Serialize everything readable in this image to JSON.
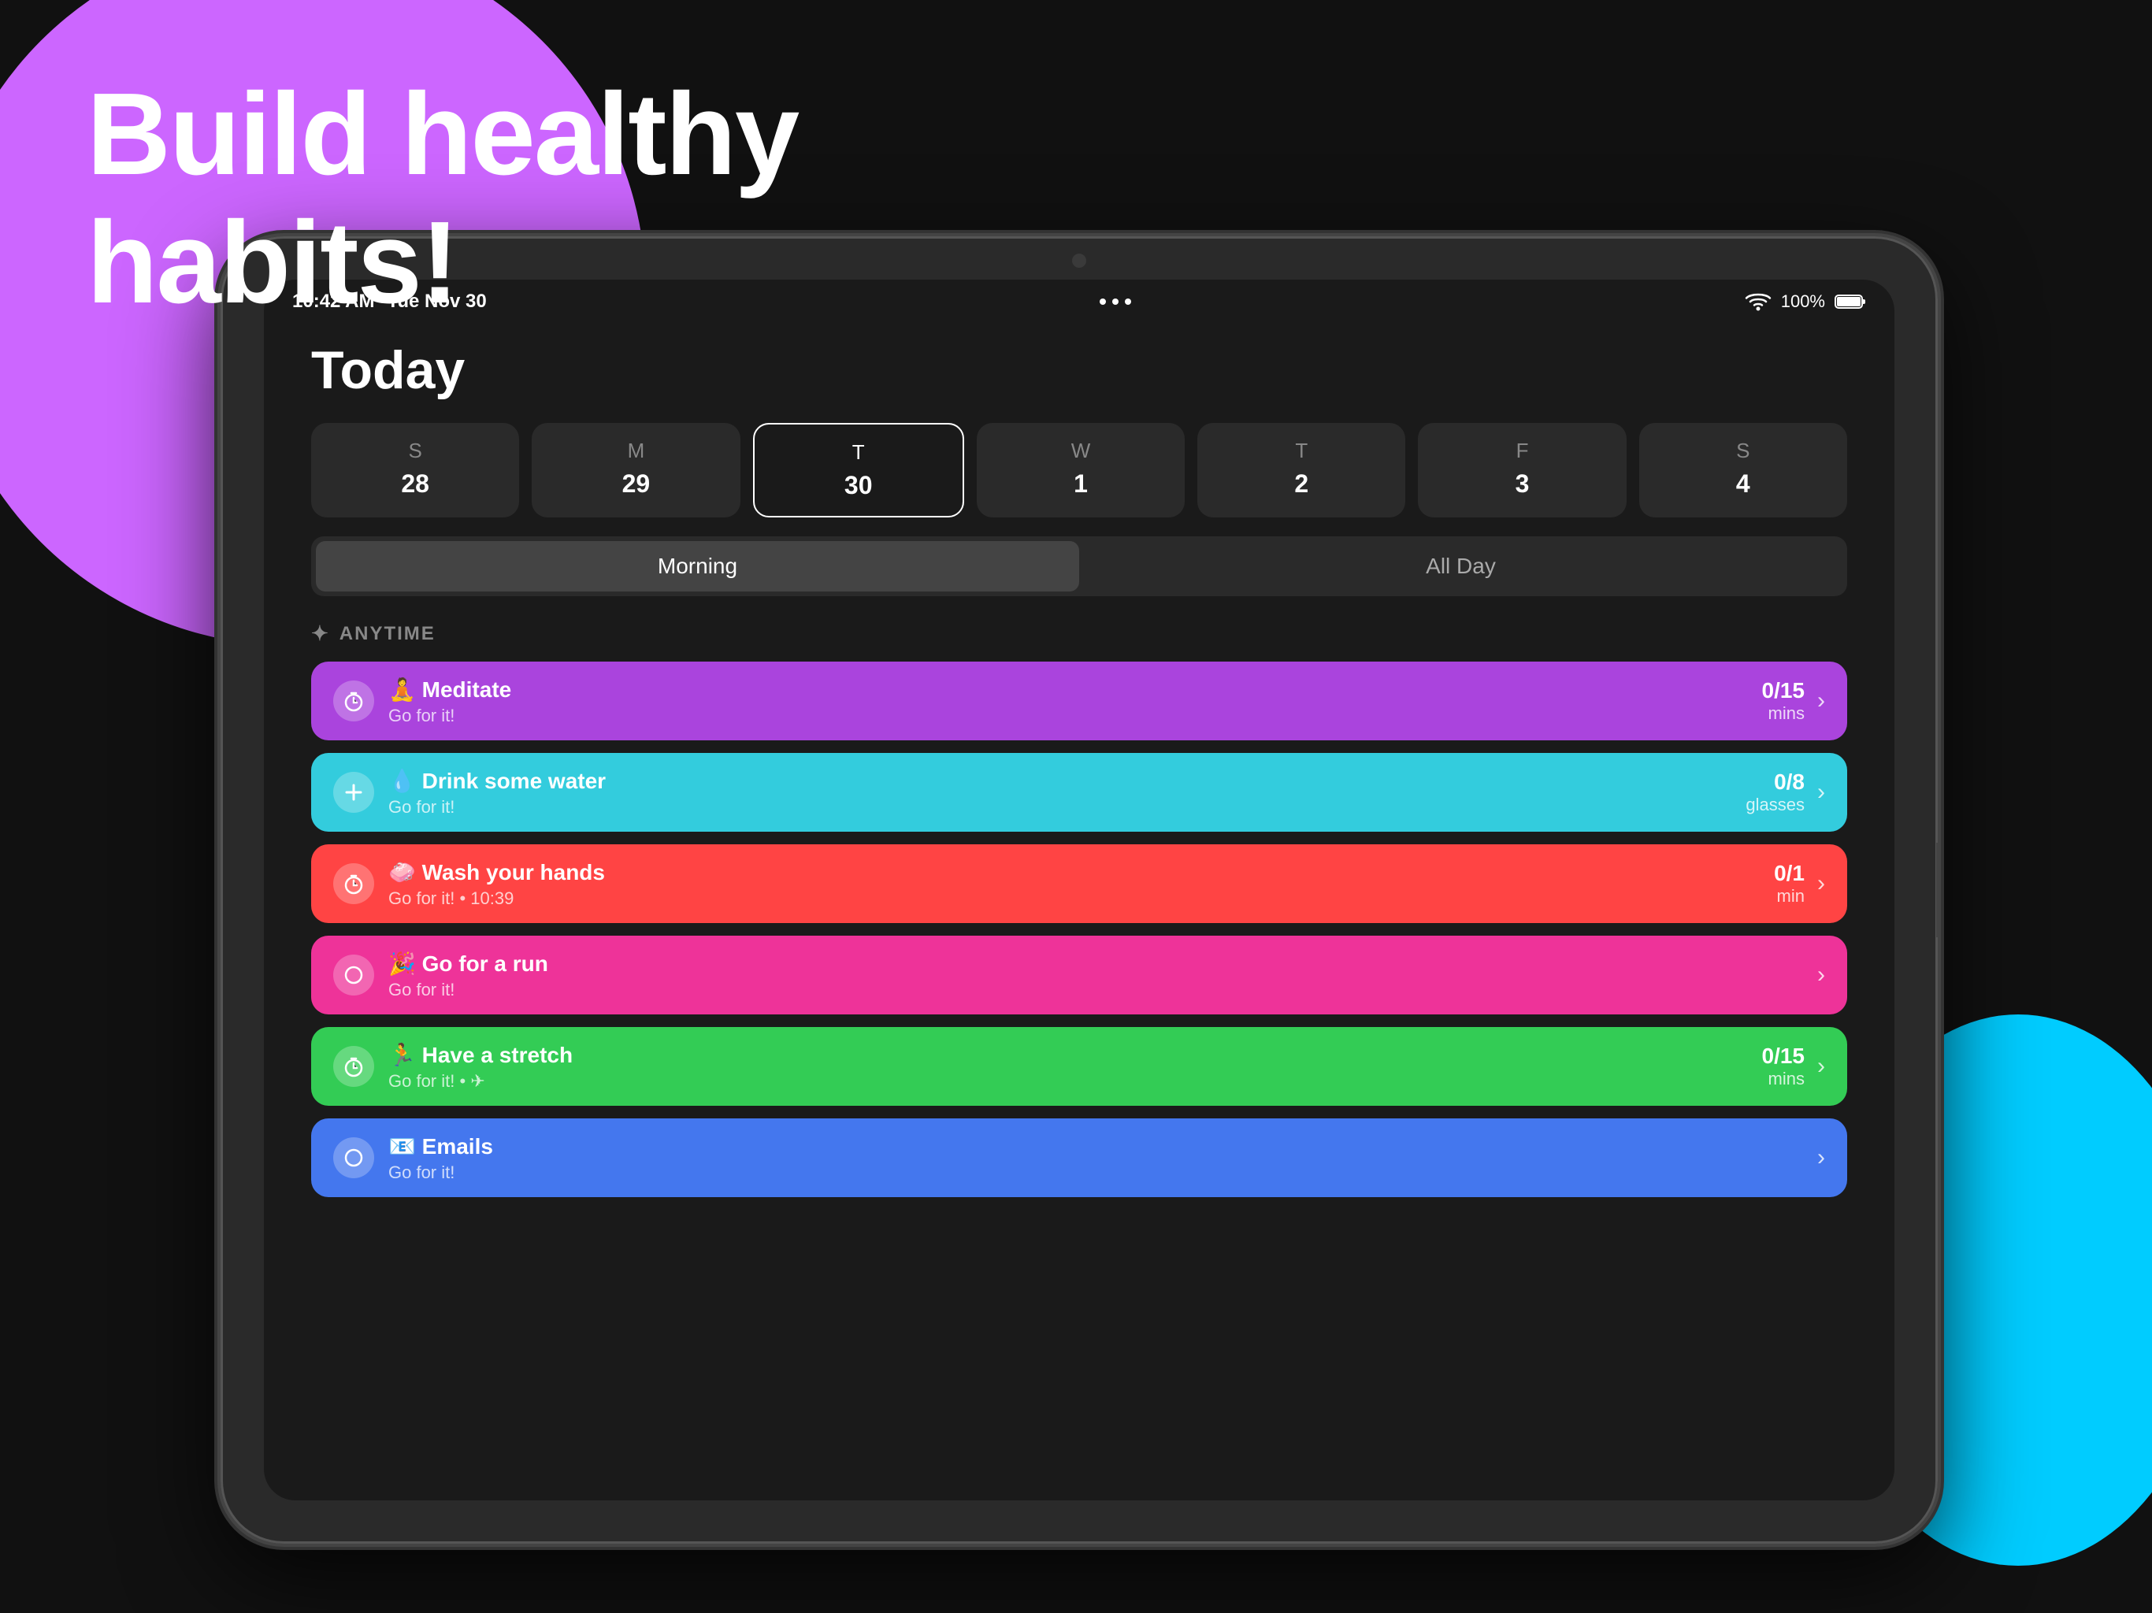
{
  "background": {
    "headline_line1": "Build healthy",
    "headline_line2": "habits!"
  },
  "status_bar": {
    "time": "10:42 AM",
    "date": "Tue Nov 30",
    "battery": "100%"
  },
  "app": {
    "title": "Today",
    "section_label": "ANYTIME",
    "days": [
      {
        "letter": "S",
        "number": "28",
        "active": false
      },
      {
        "letter": "M",
        "number": "29",
        "active": false
      },
      {
        "letter": "T",
        "number": "30",
        "active": true
      },
      {
        "letter": "W",
        "number": "1",
        "active": false
      },
      {
        "letter": "T",
        "number": "2",
        "active": false
      },
      {
        "letter": "F",
        "number": "3",
        "active": false
      },
      {
        "letter": "S",
        "number": "4",
        "active": false
      }
    ],
    "tabs": [
      {
        "label": "Morning",
        "active": true
      },
      {
        "label": "All Day",
        "active": false
      }
    ],
    "habits": [
      {
        "emoji": "🧘",
        "name": "Meditate",
        "subtitle": "Go for it!",
        "count": "0/15",
        "unit": "mins",
        "color_class": "habit-purple",
        "has_chevron": true,
        "icon_type": "timer"
      },
      {
        "emoji": "💧",
        "name": "Drink some water",
        "subtitle": "Go for it!",
        "count": "0/8",
        "unit": "glasses",
        "color_class": "habit-cyan",
        "has_chevron": true,
        "icon_type": "plus"
      },
      {
        "emoji": "🧼",
        "name": "Wash your hands",
        "subtitle": "Go for it! • 10:39",
        "count": "0/1",
        "unit": "min",
        "color_class": "habit-red",
        "has_chevron": true,
        "icon_type": "timer"
      },
      {
        "emoji": "🎉",
        "name": "Go for a run",
        "subtitle": "Go for it!",
        "count": "",
        "unit": "",
        "color_class": "habit-pink",
        "has_chevron": true,
        "icon_type": "circle"
      },
      {
        "emoji": "🏃",
        "name": "Have a stretch",
        "subtitle": "Go for it! • ✈",
        "count": "0/15",
        "unit": "mins",
        "color_class": "habit-green",
        "has_chevron": true,
        "icon_type": "timer"
      },
      {
        "emoji": "📧",
        "name": "Emails",
        "subtitle": "Go for it!",
        "count": "",
        "unit": "",
        "color_class": "habit-blue",
        "has_chevron": true,
        "icon_type": "circle"
      }
    ]
  }
}
